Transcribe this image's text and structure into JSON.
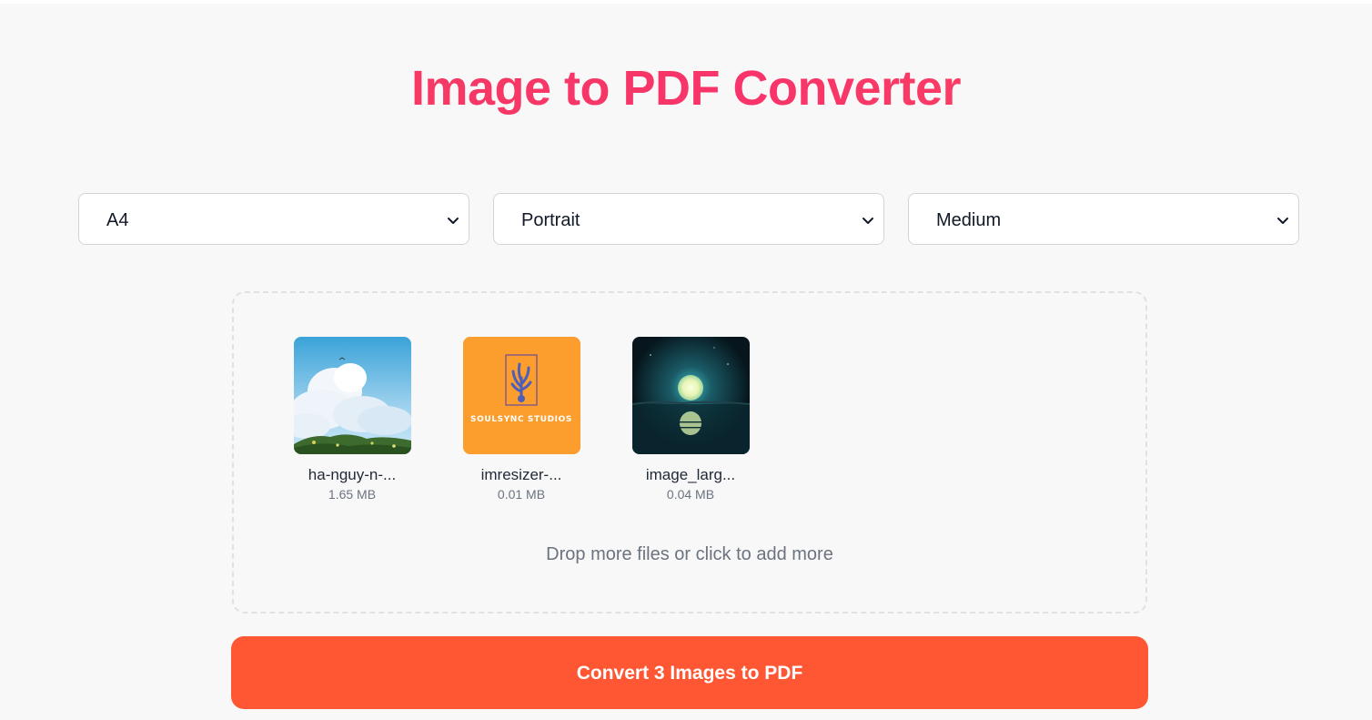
{
  "header": {
    "title": "Image to PDF Converter"
  },
  "options": {
    "page_size": "A4",
    "orientation": "Portrait",
    "quality": "Medium"
  },
  "files": [
    {
      "name": "ha-nguy-n-...",
      "size": "1.65 MB"
    },
    {
      "name": "imresizer-...",
      "size": "0.01 MB",
      "logo_text": "SOULSYNC STUDIOS"
    },
    {
      "name": "image_larg...",
      "size": "0.04 MB"
    }
  ],
  "dropzone": {
    "hint": "Drop more files or click to add more"
  },
  "convert_button": {
    "label": "Convert 3 Images to PDF"
  },
  "colors": {
    "title": "#f43f5e",
    "convert_button": "#ff5733",
    "page_background": "#f8f8f8"
  }
}
